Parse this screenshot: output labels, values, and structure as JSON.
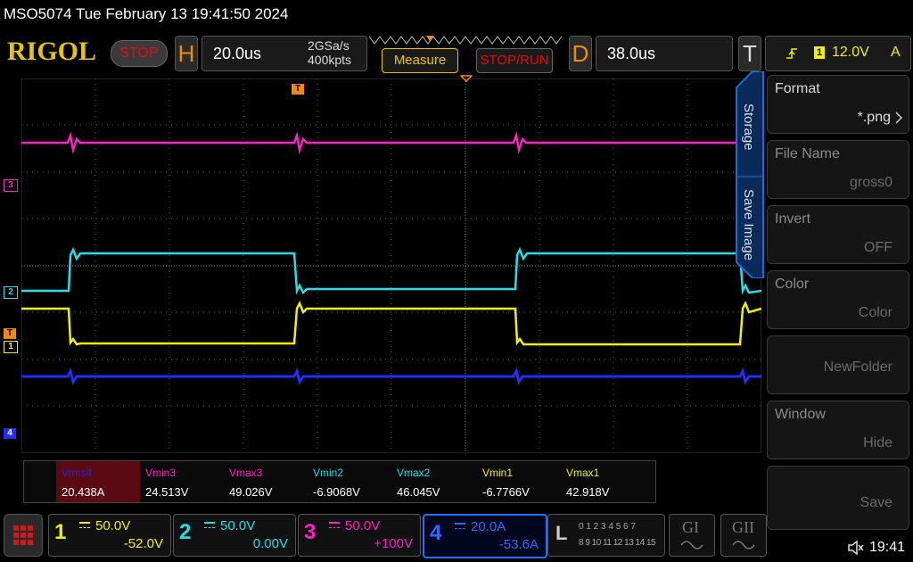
{
  "header": {
    "title": "MSO5074  Tue February 13 19:41:50 2024"
  },
  "brand": {
    "logo": "RIGOL",
    "run_state": "STOP"
  },
  "horizontal": {
    "letter": "H",
    "timebase": "20.0us",
    "sample_rate": "2GSa/s",
    "memory_depth": "400kpts"
  },
  "buttons": {
    "measure": "Measure",
    "stop_run": "STOP/RUN"
  },
  "delay": {
    "letter": "D",
    "value": "38.0us"
  },
  "trigger": {
    "letter": "T",
    "source": "1",
    "level": "12.0V",
    "mode": "A",
    "marker": "T"
  },
  "side_menu": {
    "tab_storage": "Storage",
    "tab_save_image": "Save Image",
    "items": [
      {
        "title": "Format",
        "value": "*.png"
      },
      {
        "title": "File Name",
        "value": "gross0"
      },
      {
        "title": "Invert",
        "value": "OFF"
      },
      {
        "title": "Color",
        "value": "Color"
      },
      {
        "title": "",
        "value": "NewFolder"
      },
      {
        "title": "Window",
        "value": "Hide"
      },
      {
        "title": "",
        "value": "Save"
      }
    ]
  },
  "measurements": [
    {
      "name": "Vrms4",
      "value": "20.438A",
      "color": "#2020ff"
    },
    {
      "name": "Vmin3",
      "value": "24.513V",
      "color": "#ff20c8"
    },
    {
      "name": "Vmax3",
      "value": "49.026V",
      "color": "#ff20c8"
    },
    {
      "name": "Vmin2",
      "value": "-6.9068V",
      "color": "#20e0e8"
    },
    {
      "name": "Vmax2",
      "value": "46.045V",
      "color": "#20e0e8"
    },
    {
      "name": "Vmin1",
      "value": "-6.7766V",
      "color": "#f0f000"
    },
    {
      "name": "Vmax1",
      "value": "42.918V",
      "color": "#f0f000"
    }
  ],
  "channels": [
    {
      "num": "1",
      "scale": "50.0V",
      "offset": "-52.0V",
      "color": "#f0f000"
    },
    {
      "num": "2",
      "scale": "50.0V",
      "offset": "0.00V",
      "color": "#20e0e8"
    },
    {
      "num": "3",
      "scale": "50.0V",
      "offset": "+100V",
      "color": "#ff20c8"
    },
    {
      "num": "4",
      "scale": "20.0A",
      "offset": "-53.6A",
      "color": "#2a6bff"
    }
  ],
  "logic": {
    "letter": "L",
    "row1": "0 1 2 3  4 5 6 7",
    "row2": "8 9 10 11 12 13 14 15"
  },
  "generators": {
    "g1": "GI",
    "g2": "GII"
  },
  "status": {
    "time": "19:41"
  },
  "channel_markers": {
    "ch3": "3",
    "ch2": "2",
    "ch1": "1",
    "ch4": "4",
    "trig": "T"
  },
  "colors": {
    "ch1": "#f0f000",
    "ch2": "#20e0e8",
    "ch3": "#ff20c8",
    "ch4": "#1f2fff",
    "accent": "#f28a10",
    "stop": "#e01010"
  }
}
